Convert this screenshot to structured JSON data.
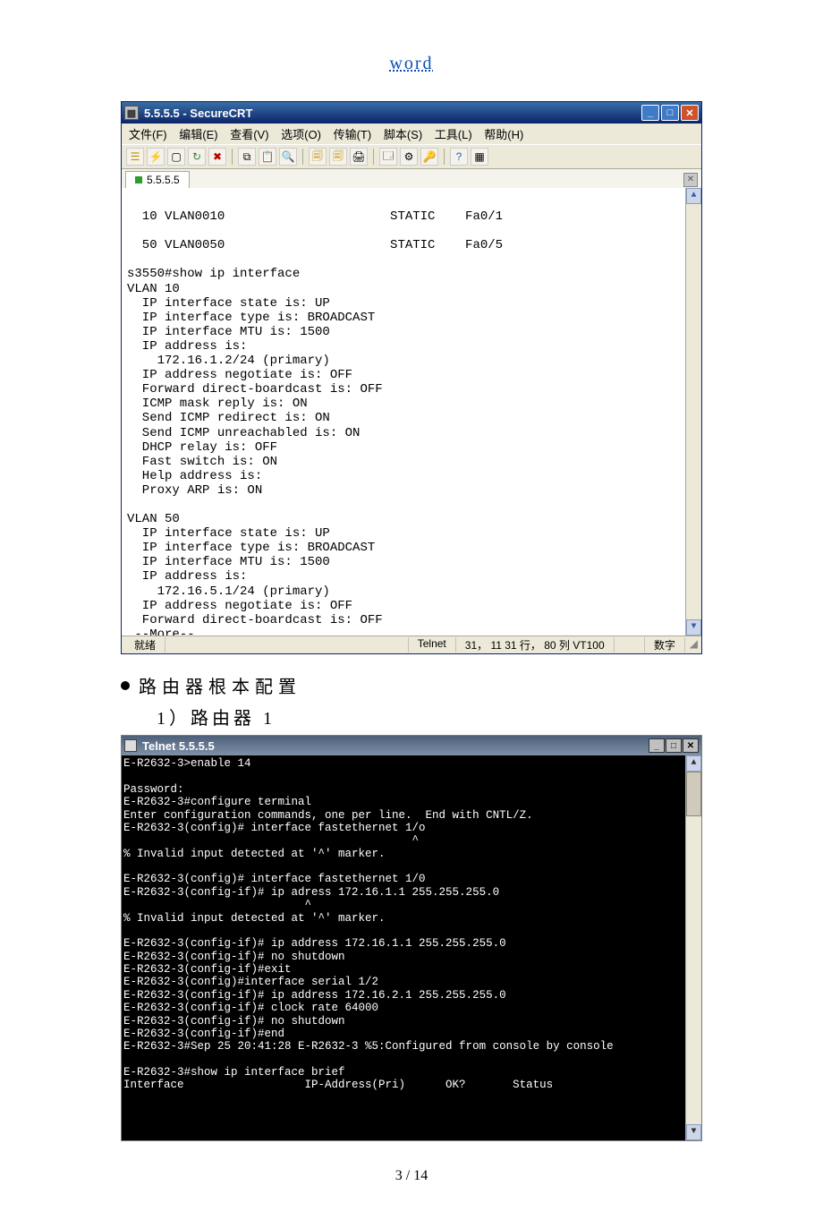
{
  "header_link": "word",
  "footer": "3 / 14",
  "bullet_text": "路由器根本配置",
  "sub_text": "1）路由器 1",
  "securecrt": {
    "title": "5.5.5.5 - SecureCRT",
    "menu": [
      "文件(F)",
      "编辑(E)",
      "查看(V)",
      "选项(O)",
      "传输(T)",
      "脚本(S)",
      "工具(L)",
      "帮助(H)"
    ],
    "tab_label": "5.5.5.5",
    "terminal": "\n  10 VLAN0010                      STATIC    Fa0/1\n\n  50 VLAN0050                      STATIC    Fa0/5\n\ns3550#show ip interface\nVLAN 10\n  IP interface state is: UP\n  IP interface type is: BROADCAST\n  IP interface MTU is: 1500\n  IP address is:\n    172.16.1.2/24 (primary)\n  IP address negotiate is: OFF\n  Forward direct-boardcast is: OFF\n  ICMP mask reply is: ON\n  Send ICMP redirect is: ON\n  Send ICMP unreachabled is: ON\n  DHCP relay is: OFF\n  Fast switch is: ON\n  Help address is:\n  Proxy ARP is: ON\n\nVLAN 50\n  IP interface state is: UP\n  IP interface type is: BROADCAST\n  IP interface MTU is: 1500\n  IP address is:\n    172.16.5.1/24 (primary)\n  IP address negotiate is: OFF\n  Forward direct-boardcast is: OFF\n --More--",
    "status": {
      "ready": "就绪",
      "proto": "Telnet",
      "pos": "31， 11  31 行， 80 列  VT100",
      "numlock": "数字"
    }
  },
  "telnet": {
    "title": "Telnet 5.5.5.5",
    "terminal": "E-R2632-3>enable 14\n\nPassword:\nE-R2632-3#configure terminal\nEnter configuration commands, one per line.  End with CNTL/Z.\nE-R2632-3(config)# interface fastethernet 1/o\n                                           ^\n% Invalid input detected at '^' marker.\n\nE-R2632-3(config)# interface fastethernet 1/0\nE-R2632-3(config-if)# ip adress 172.16.1.1 255.255.255.0\n                           ^\n% Invalid input detected at '^' marker.\n\nE-R2632-3(config-if)# ip address 172.16.1.1 255.255.255.0\nE-R2632-3(config-if)# no shutdown\nE-R2632-3(config-if)#exit\nE-R2632-3(config)#interface serial 1/2\nE-R2632-3(config-if)# ip address 172.16.2.1 255.255.255.0\nE-R2632-3(config-if)# clock rate 64000\nE-R2632-3(config-if)# no shutdown\nE-R2632-3(config-if)#end\nE-R2632-3#Sep 25 20:41:28 E-R2632-3 %5:Configured from console by console\n\nE-R2632-3#show ip interface brief\nInterface                  IP-Address(Pri)      OK?       Status"
  }
}
